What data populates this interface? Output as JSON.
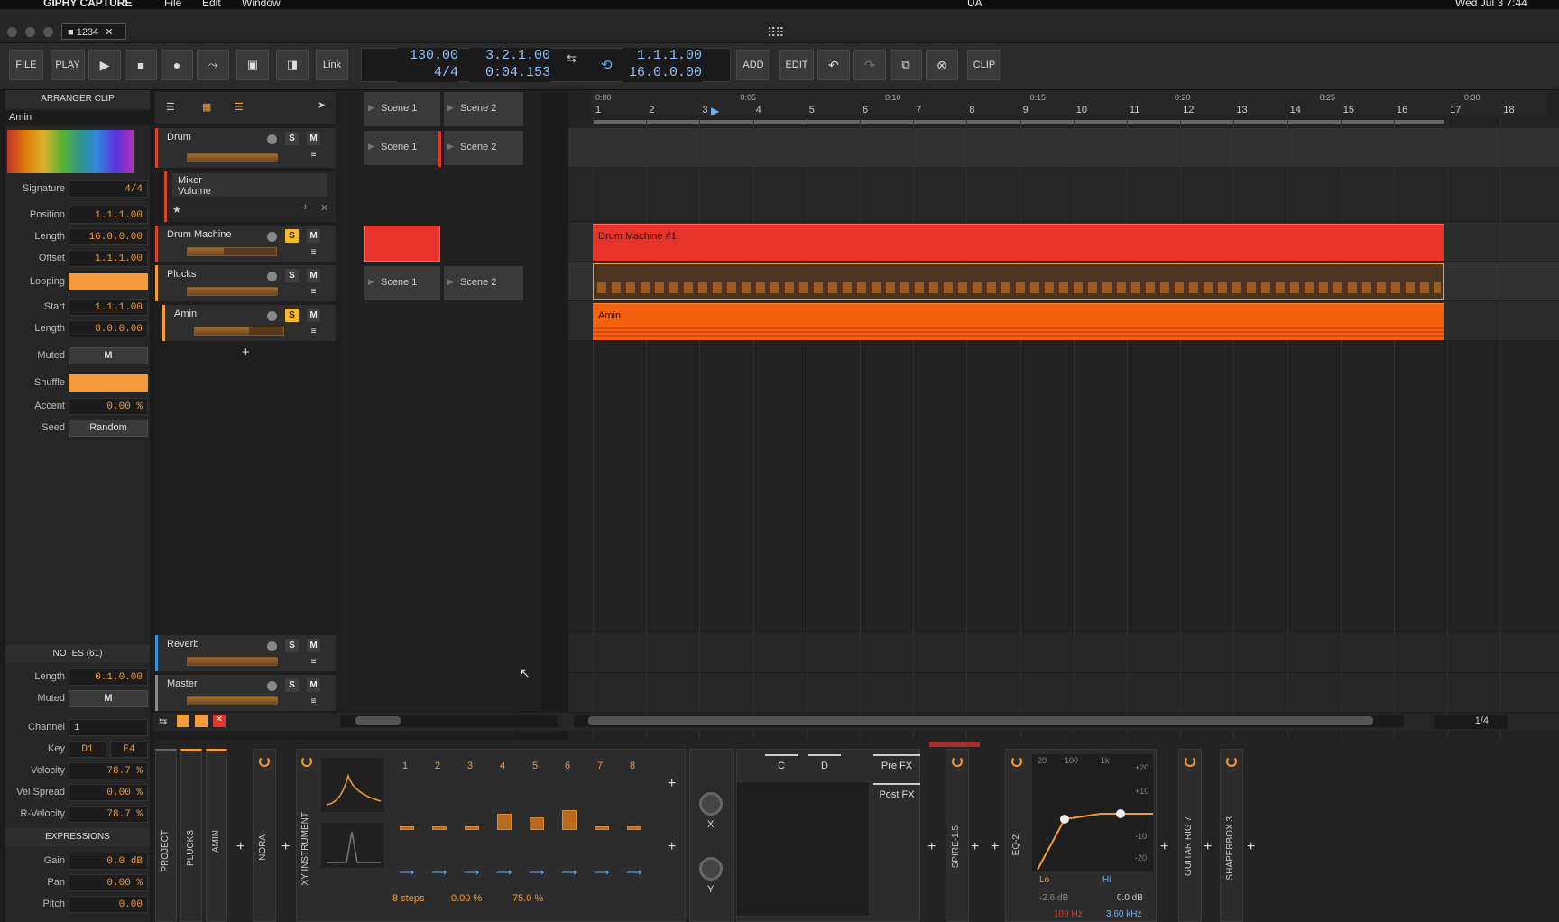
{
  "menubar": {
    "app": "GIPHY CAPTURE",
    "items": [
      "File",
      "Edit",
      "Window"
    ],
    "clock": "Wed Jul 3  7:44",
    "ua": "UA"
  },
  "window": {
    "tab": "1234"
  },
  "toolbar": {
    "file": "FILE",
    "play": "PLAY",
    "link": "Link",
    "tempo": "130.00",
    "signature": "4/4",
    "position": "3.2.1.00",
    "time": "0:04.153",
    "loop_start": "1.1.1.00",
    "loop_length": "16.0.0.00",
    "add": "ADD",
    "edit": "EDIT",
    "clip": "CLIP"
  },
  "inspector": {
    "header": "ARRANGER CLIP",
    "clip_name": "Amin",
    "fields": [
      {
        "label": "Signature",
        "value": "4/4"
      },
      {
        "label": "Position",
        "value": "1.1.1.00"
      },
      {
        "label": "Length",
        "value": "16.0.0.00"
      },
      {
        "label": "Offset",
        "value": "1.1.1.00"
      },
      {
        "label": "Looping",
        "value": ""
      },
      {
        "label": "Start",
        "value": "1.1.1.00"
      },
      {
        "label": "Length",
        "value": "8.0.0.00"
      },
      {
        "label": "Muted",
        "value": "M"
      },
      {
        "label": "Shuffle",
        "value": ""
      },
      {
        "label": "Accent",
        "value": "0.00 %"
      },
      {
        "label": "Seed",
        "value": "Random"
      }
    ],
    "notes_header": "NOTES (61)",
    "notes": [
      {
        "label": "Length",
        "value": "0.1.0.00"
      },
      {
        "label": "Muted",
        "value": "M"
      },
      {
        "label": "Channel",
        "value": "1"
      },
      {
        "label": "Key",
        "value": "D1",
        "value2": "E4"
      },
      {
        "label": "Velocity",
        "value": "78.7 %"
      },
      {
        "label": "Vel Spread",
        "value": "0.00 %"
      },
      {
        "label": "R-Velocity",
        "value": "78.7 %"
      }
    ],
    "expr_header": "EXPRESSIONS",
    "expressions": [
      {
        "label": "Gain",
        "value": "0.0 dB"
      },
      {
        "label": "Pan",
        "value": "0.00 %"
      },
      {
        "label": "Pitch",
        "value": "0.00"
      }
    ]
  },
  "tracks": [
    {
      "name": "Drum",
      "color": "#d8432a"
    },
    {
      "name": "Drum Machine",
      "color": "#d8432a"
    },
    {
      "name": "Plucks",
      "color": "#f39a3a"
    },
    {
      "name": "Amin",
      "color": "#f39a3a"
    },
    {
      "name": "Reverb",
      "color": "#3a8fd8"
    },
    {
      "name": "Master",
      "color": "#888888"
    }
  ],
  "mixer_param": {
    "line1": "Mixer",
    "line2": "Volume"
  },
  "scenes": {
    "scene1": "Scene 1",
    "scene2": "Scene 2"
  },
  "ruler": {
    "bars": [
      "1",
      "2",
      "3",
      "4",
      "5",
      "6",
      "7",
      "8",
      "9",
      "10",
      "11",
      "12",
      "13",
      "14",
      "15",
      "16",
      "17",
      "18"
    ],
    "times": [
      "0:00",
      "0:05",
      "0:10",
      "0:15",
      "0:20",
      "0:25",
      "0:30"
    ]
  },
  "clips": {
    "drum_machine": "Drum Machine #1",
    "amin": "Amin"
  },
  "bottom": {
    "zoom": "1/4"
  },
  "devices": {
    "labels": [
      "PROJECT",
      "PLUCKS",
      "AMIN",
      "NORA",
      "XY INSTRUMENT",
      "SPIRE-1.5",
      "EQ-2",
      "GUITAR RIG 7",
      "SHAPERBOX 3"
    ],
    "steps": [
      "1",
      "2",
      "3",
      "4",
      "5",
      "6",
      "7",
      "8"
    ],
    "step_count": "8 steps",
    "step_pct": "0.00 %",
    "step_pct2": "75.0 %",
    "xy_x": "X",
    "xy_y": "Y",
    "chain_c": "C",
    "chain_d": "D",
    "prefx": "Pre FX",
    "postfx": "Post FX",
    "eq_freqs": [
      "20",
      "100",
      "1k"
    ],
    "eq_db": [
      "+20",
      "+10",
      "-10",
      "-20"
    ],
    "eq_lo": "Lo",
    "eq_hi": "Hi",
    "eq_g1": "-2.6 dB",
    "eq_g2": "0.0 dB",
    "eq_f1": "109 Hz",
    "eq_f2": "3.60 kHz"
  },
  "colors": {
    "accent": "#f39a3a",
    "clip_red": "#e8332a",
    "clip_orange": "#f5620f",
    "value_blue": "#8fc3ff"
  }
}
